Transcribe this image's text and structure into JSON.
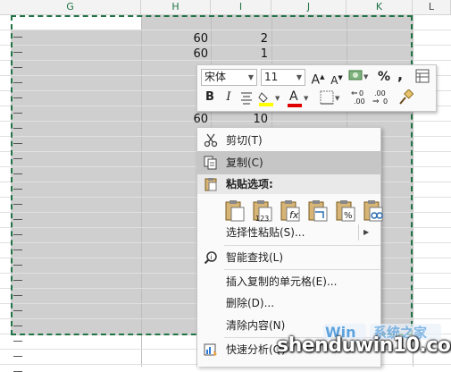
{
  "sheet": {
    "columns": [
      "G",
      "H",
      "I",
      "J",
      "K",
      "L"
    ],
    "rows": [
      {
        "h": "",
        "i": ""
      },
      {
        "h": "60",
        "i": "2"
      },
      {
        "h": "60",
        "i": "1"
      },
      {
        "h": "60",
        "i": "10"
      }
    ]
  },
  "mini_toolbar": {
    "font_name": "宋体",
    "font_size": "11",
    "grow_font": "A",
    "shrink_font": "A",
    "percent": "%",
    "comma": ",",
    "bold": "B",
    "italic": "I",
    "font_color": "A",
    "dec_more": ".00",
    "dec_less": ".00"
  },
  "context_menu": {
    "cut": "剪切(T)",
    "copy": "复制(C)",
    "paste_options_header": "粘贴选项:",
    "paste_special": "选择性粘贴(S)...",
    "smart_lookup": "智能查找(L)",
    "insert_copied": "插入复制的单元格(E)...",
    "delete": "删除(D)...",
    "clear": "清除内容(N)",
    "quick_analysis": "快速分析(Q)"
  },
  "watermark": {
    "text": "shenduwin10.com"
  }
}
